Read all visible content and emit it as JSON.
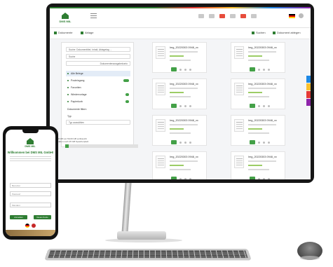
{
  "colors": {
    "brand_green": "#2e7d32",
    "badge_green": "#43a047",
    "side_tabs": [
      "#1e88e5",
      "#fbc02d",
      "#e53935",
      "#8e24aa"
    ]
  },
  "app": {
    "logo_text": "DMS MIL",
    "toolbar": [
      "Dokumente",
      "Ablage",
      "Suchen",
      "Dokument ablegen"
    ],
    "top_icons": [
      "grid-icon",
      "bell-icon",
      "mail-icon",
      "settings-icon",
      "help-icon",
      "flag-de-icon",
      "user-icon"
    ]
  },
  "left_panel": {
    "search_placeholder": "Suche: Dokumenttitel, Inhalt, Ablagetag ...",
    "filter_value": "Suche",
    "select_value": "Dokumentenausgabekonto",
    "nav": [
      {
        "label": "Alle Belege",
        "badge": false
      },
      {
        "label": "Posteingang",
        "badge": true
      },
      {
        "label": "Favoriten",
        "badge": false
      },
      {
        "label": "Wiedervorlage",
        "badge": true
      },
      {
        "label": "Papierkorb",
        "badge": true
      }
    ],
    "section_label": "Dokumente filtern",
    "type_label": "Typ",
    "type_value": "Typ auswählen",
    "note_line1": "25,00 GB von 50,00 GB verbraucht",
    "note_line2": "Sie haben noch 25 GB Speicherplatz",
    "storage_used": 0.05
  },
  "documents": [
    {
      "name": "Img_20220303 0948_xx"
    },
    {
      "name": "Img_20220303 0948_xx"
    },
    {
      "name": "Img_20220303 0948_xx"
    },
    {
      "name": "Img_20220303 0948_xx"
    },
    {
      "name": "Img_20220303 0948_xx"
    },
    {
      "name": "Img_20220303 0948_xx"
    },
    {
      "name": "Img_20220303 0948_xx"
    },
    {
      "name": "Img_20220303 0948_xx"
    }
  ],
  "phone": {
    "brand": "DMS MIL",
    "title": "Willkommen bei DMS MIL GmbH!",
    "fields": [
      "Benutzer",
      "Passwort",
      "Mandant"
    ],
    "buttons": [
      "Anmelden",
      "Neues Konto"
    ]
  }
}
